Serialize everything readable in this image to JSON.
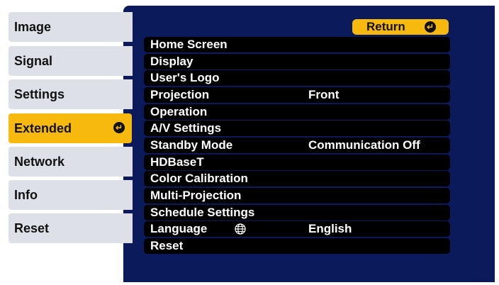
{
  "tabs": [
    {
      "label": "Image"
    },
    {
      "label": "Signal"
    },
    {
      "label": "Settings"
    },
    {
      "label": "Extended",
      "active": true
    },
    {
      "label": "Network"
    },
    {
      "label": "Info"
    },
    {
      "label": "Reset"
    }
  ],
  "return_button": {
    "label": "Return"
  },
  "items": [
    {
      "label": "Home Screen",
      "value": ""
    },
    {
      "label": "Display",
      "value": ""
    },
    {
      "label": "User's Logo",
      "value": ""
    },
    {
      "label": "Projection",
      "value": "Front"
    },
    {
      "label": "Operation",
      "value": ""
    },
    {
      "label": "A/V Settings",
      "value": ""
    },
    {
      "label": "Standby Mode",
      "value": "Communication Off"
    },
    {
      "label": "HDBaseT",
      "value": ""
    },
    {
      "label": "Color Calibration",
      "value": ""
    },
    {
      "label": "Multi-Projection",
      "value": ""
    },
    {
      "label": "Schedule Settings",
      "value": ""
    },
    {
      "label": "Language",
      "value": "English",
      "icon": "globe-icon"
    },
    {
      "label": "Reset",
      "value": ""
    }
  ],
  "colors": {
    "menu_background": "#0b1a5a",
    "highlight": "#f7b90d",
    "tab_background": "#dde1e7",
    "item_background": "#000000"
  }
}
